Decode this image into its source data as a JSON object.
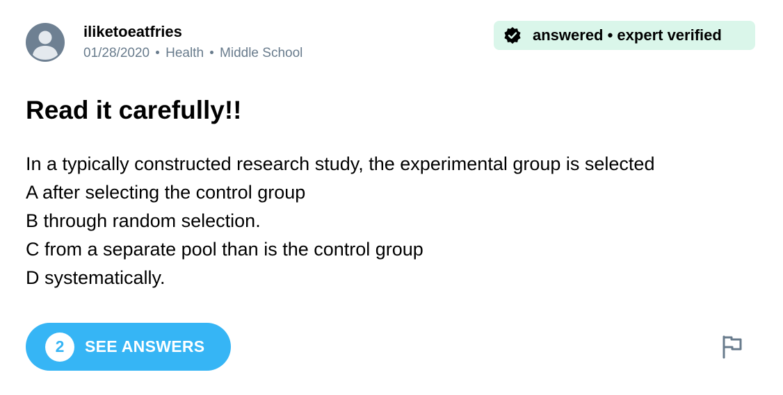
{
  "author": {
    "username": "iliketoeatfries",
    "avatar_icon": "user-avatar-icon"
  },
  "meta": {
    "date": "01/28/2020",
    "subject": "Health",
    "level": "Middle School"
  },
  "badge": {
    "icon": "verified-check-icon",
    "text": "answered • expert verified"
  },
  "question": {
    "title": "Read it carefully!!",
    "lines": [
      "In a typically constructed research study, the experimental group is selected",
      "A after selecting the control group",
      "B through random selection.",
      "C from a separate pool than is the control group",
      "D systematically."
    ]
  },
  "answers_button": {
    "count": "2",
    "label": "SEE ANSWERS"
  },
  "report": {
    "icon": "flag-icon"
  },
  "colors": {
    "accent_blue": "#36b5f5",
    "badge_bg": "#daf6ea",
    "meta_gray": "#687b8c",
    "avatar_gray": "#6e8092"
  }
}
